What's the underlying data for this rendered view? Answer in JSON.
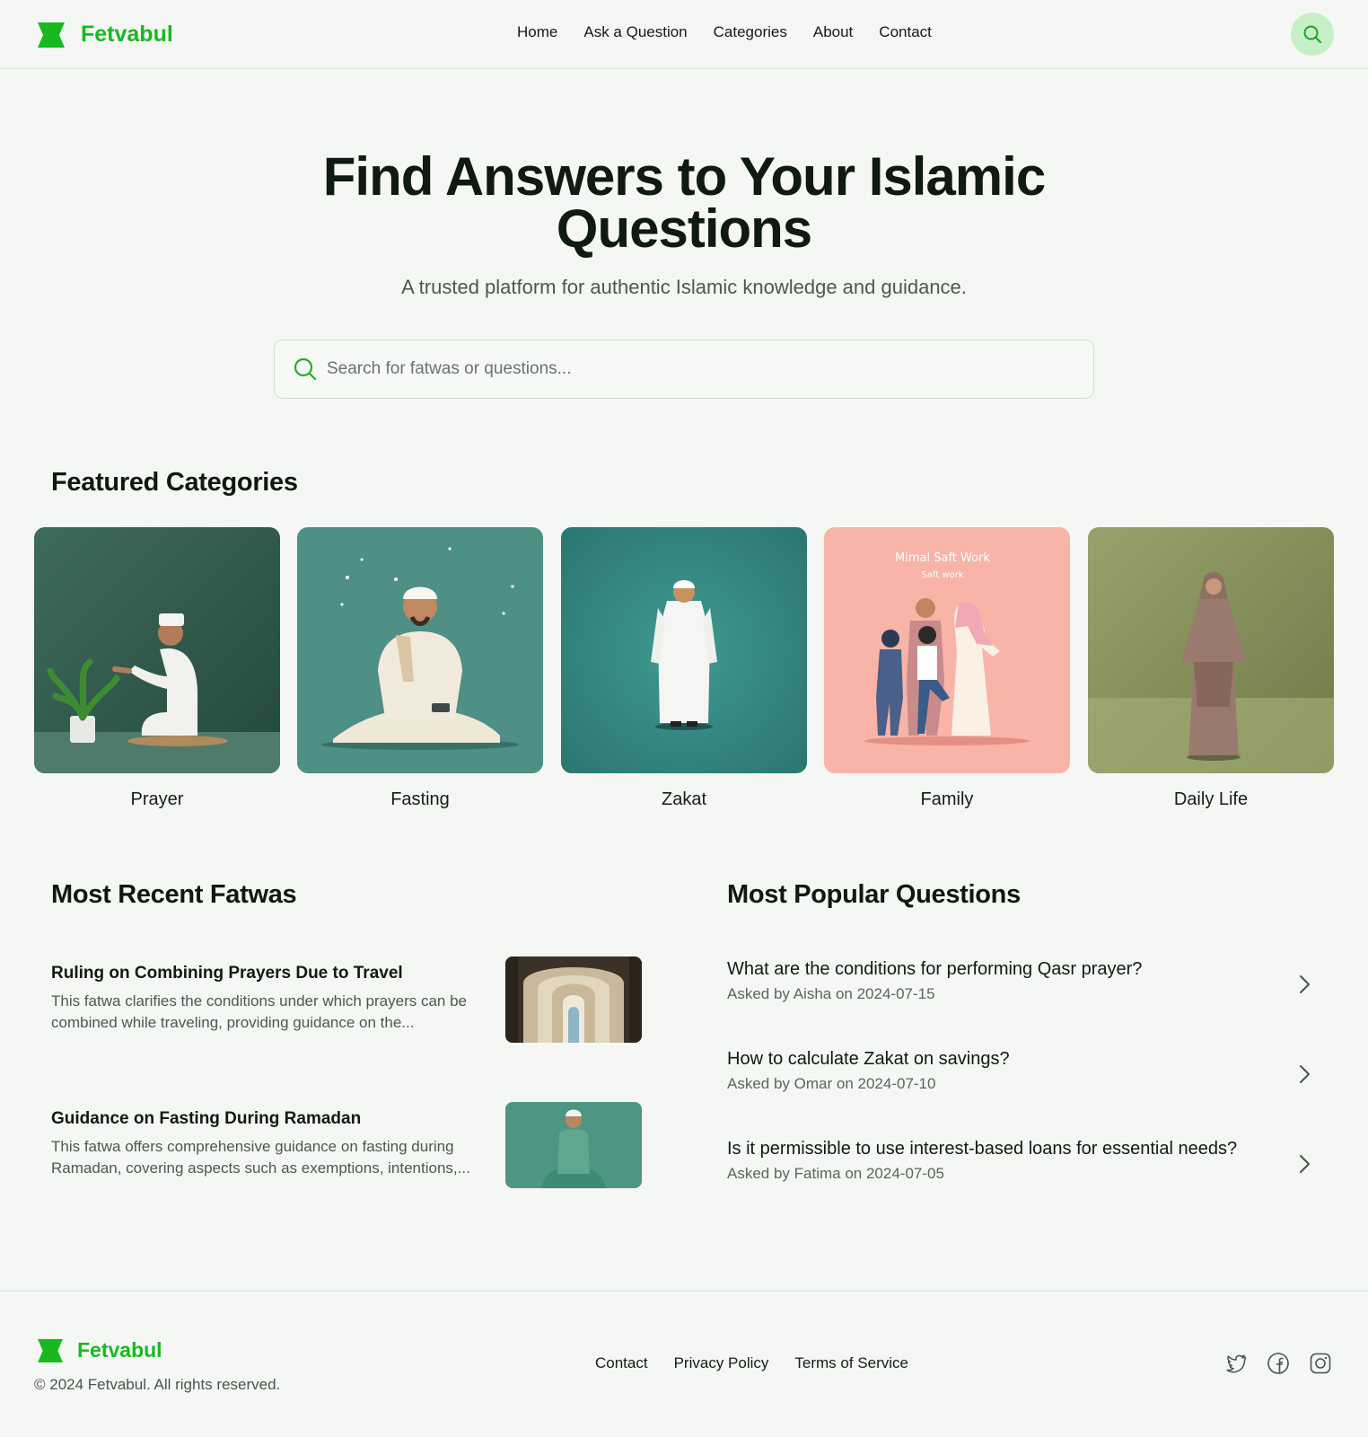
{
  "brand": {
    "name": "Fetvabul",
    "color": "#18b91f"
  },
  "nav": [
    "Home",
    "Ask a Question",
    "Categories",
    "About",
    "Contact"
  ],
  "hero": {
    "title_line1": "Find Answers to Your Islamic",
    "title_line2": "Questions",
    "subtitle": "A trusted platform for authentic Islamic knowledge and guidance.",
    "search_placeholder": "Search for fatwas or questions..."
  },
  "featured": {
    "title": "Featured Categories",
    "categories": [
      "Prayer",
      "Fasting",
      "Zakat",
      "Family",
      "Daily Life"
    ],
    "family_image_text": [
      "Mimal Saft Work",
      "Saft work"
    ]
  },
  "recent": {
    "title": "Most Recent Fatwas",
    "items": [
      {
        "title": "Ruling on Combining Prayers Due to Travel",
        "desc": "This fatwa clarifies the conditions under which prayers can be combined while traveling, providing guidance on the..."
      },
      {
        "title": "Guidance on Fasting During Ramadan",
        "desc": "This fatwa offers comprehensive guidance on fasting during Ramadan, covering aspects such as exemptions, intentions,..."
      }
    ]
  },
  "popular": {
    "title": "Most Popular Questions",
    "items": [
      {
        "title": "What are the conditions for performing Qasr prayer?",
        "meta": "Asked by Aisha on 2024-07-15"
      },
      {
        "title": "How to calculate Zakat on savings?",
        "meta": "Asked by Omar on 2024-07-10"
      },
      {
        "title": "Is it permissible to use interest-based loans for essential needs?",
        "meta": "Asked by Fatima on 2024-07-05"
      }
    ]
  },
  "footer": {
    "copyright": "© 2024 Fetvabul. All rights reserved.",
    "links": [
      "Contact",
      "Privacy Policy",
      "Terms of Service"
    ],
    "social": [
      "twitter-icon",
      "facebook-icon",
      "instagram-icon"
    ]
  }
}
